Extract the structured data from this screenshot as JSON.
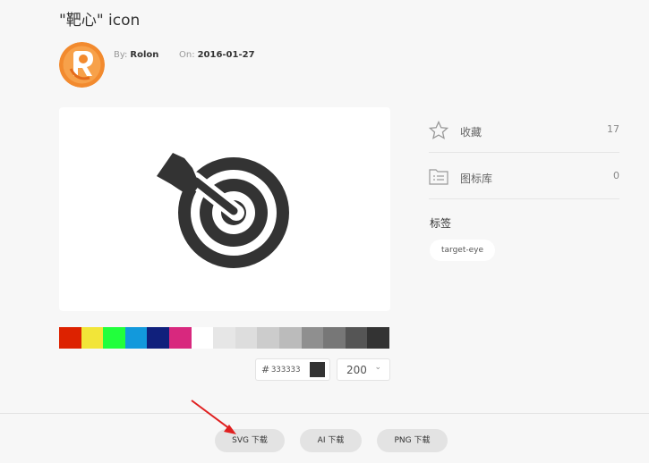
{
  "page": {
    "title": "\"靶心\" icon"
  },
  "author": {
    "by_label": "By:",
    "name": "Rolon",
    "on_label": "On:",
    "date": "2016-01-27"
  },
  "icon": {
    "name": "target-eye-icon",
    "color": "#333333"
  },
  "palette": [
    "#dd2200",
    "#f2e538",
    "#21ff3c",
    "#1299dc",
    "#10207c",
    "#d8287e",
    "#ffffff",
    "#e6e6e6",
    "#dddddd",
    "#cccccc",
    "#bbbbbb",
    "#8f8f8f",
    "#777777",
    "#555555",
    "#333333"
  ],
  "color_picker": {
    "hash": "#",
    "value": "333333"
  },
  "size_select": {
    "value": "200",
    "chevron": "⌄"
  },
  "sidebar": {
    "favorite": {
      "label": "收藏",
      "count": "17"
    },
    "library": {
      "label": "图标库",
      "count": "0"
    },
    "tags_title": "标签",
    "tags": [
      "target-eye"
    ]
  },
  "downloads": {
    "svg": "SVG 下载",
    "ai": "AI 下载",
    "png": "PNG 下载"
  }
}
